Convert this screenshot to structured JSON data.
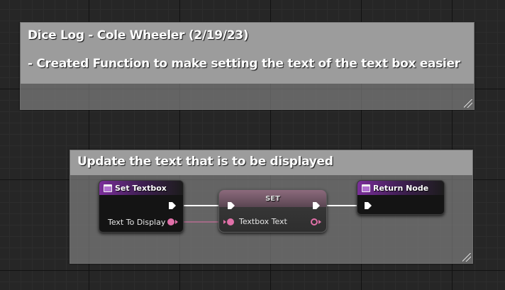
{
  "comments": {
    "log": {
      "title": "Dice Log - Cole Wheeler (2/19/23)",
      "note": "- Created Function to make setting the text of the text box easier"
    },
    "graph": {
      "title": "Update the text that is to be displayed"
    }
  },
  "nodes": {
    "entry": {
      "title": "Set Textbox",
      "param_label": "Text To Display",
      "icon": "function-icon"
    },
    "set": {
      "title": "SET",
      "input_label": "Textbox Text"
    },
    "return": {
      "title": "Return Node",
      "icon": "function-icon"
    }
  },
  "colors": {
    "exec_wire": "#ffffff",
    "text_wire": "#e070a8",
    "function_header": "#7a2e9a",
    "comment_fill": "#9c9c9c",
    "graph_background": "#262626"
  }
}
